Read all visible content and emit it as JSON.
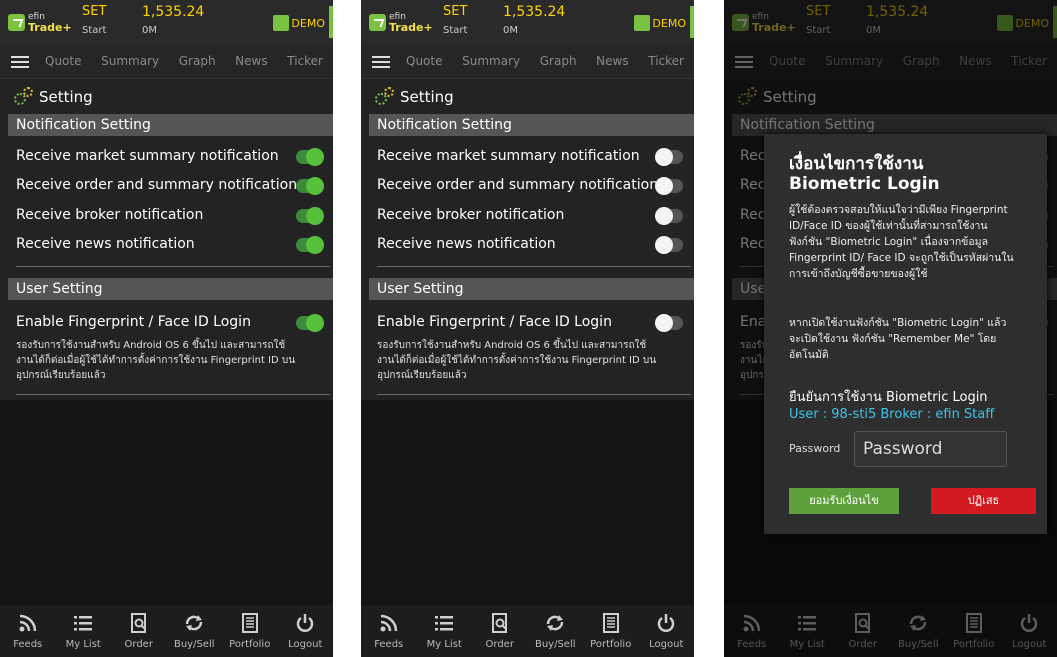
{
  "common": {
    "logo_line1": "efin",
    "logo_line2": "Trade+",
    "index_name": "SET",
    "index_status": "Start",
    "index_value": "1,535.24",
    "index_volume": "0M",
    "demo_label": "DEMO",
    "nav_tabs": [
      "Quote",
      "Summary",
      "Graph",
      "News",
      "Ticker"
    ],
    "page_title": "Setting",
    "notification_header": "Notification Setting",
    "user_header": "User Setting",
    "notification_items": [
      "Receive market summary notification",
      "Receive order and summary notification",
      "Receive broker notification",
      "Receive news notification"
    ],
    "fingerprint_label": "Enable Fingerprint / Face ID Login",
    "fingerprint_desc": "รองรับการใช้งานสำหรับ Android OS 6 ขึ้นไป และสามารถใช้งานได้ก็ต่อเมื่อผู้ใช้ได้ทำการตั้งค่าการใช้งาน Fingerprint ID บนอุปกรณ์เรียบร้อยแล้ว",
    "bottom_nav": [
      {
        "label": "Feeds",
        "icon": "rss-icon"
      },
      {
        "label": "My List",
        "icon": "list-icon"
      },
      {
        "label": "Order",
        "icon": "order-icon"
      },
      {
        "label": "Buy/Sell",
        "icon": "buysell-icon"
      },
      {
        "label": "Portfolio",
        "icon": "portfolio-icon"
      },
      {
        "label": "Logout",
        "icon": "power-icon"
      }
    ]
  },
  "screens": [
    {
      "toggles": [
        true,
        true,
        true,
        true
      ],
      "fingerprint_toggle": true
    },
    {
      "toggles": [
        false,
        false,
        false,
        false
      ],
      "fingerprint_toggle": false
    },
    {
      "toggles": [
        true,
        true,
        true,
        true
      ],
      "fingerprint_toggle": true
    }
  ],
  "modal": {
    "title_line1": "เงื่อนไขการใช้งาน",
    "title_line2": "Biometric Login",
    "paragraph1": "ผู้ใช้ต้องตรวจสอบให้แน่ใจว่ามีเพียง Fingerprint ID/Face ID ของผู้ใช้เท่านั้นที่สามารถใช้งานฟังก์ชัน \"Biometric Login\" เนื่องจากข้อมูล Fingerprint ID/ Face ID จะถูกใช้เป็นรหัสผ่านในการเข้าถึงบัญชีซื้อขายของผู้ใช้",
    "paragraph2": "หากเปิดใช้งานฟังก์ชัน \"Biometric Login\" แล้ว จะเปิดใช้งาน ฟังก์ชัน \"Remember Me\" โดยอัตโนมัติ",
    "confirm_text": "ยืนยันการใช้งาน Biometric Login",
    "user_info": "User : 98-sti5 Broker : efin Staff",
    "password_label": "Password",
    "password_placeholder": "Password",
    "accept_label": "ยอมรับเงื่อนไข",
    "reject_label": "ปฏิเสธ"
  }
}
